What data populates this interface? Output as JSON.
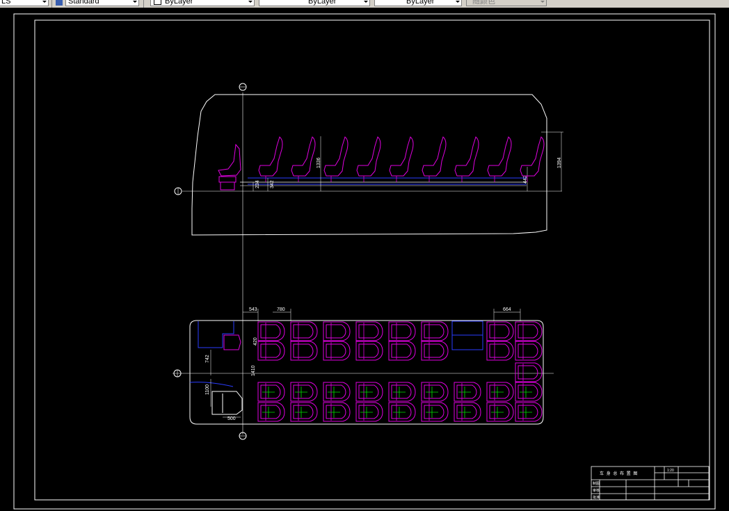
{
  "toolbar": {
    "combo1": "LS",
    "combo2": "Standard",
    "combo3": "ByLayer",
    "combo4": "ByLayer",
    "combo5": "ByLayer",
    "combo6": "随颜色"
  },
  "drawing": {
    "side_dims": [
      "234",
      "342",
      "1336",
      "442",
      "1394"
    ],
    "plan_dims": [
      "543",
      "780",
      "664",
      "420",
      "1410",
      "742",
      "1100",
      "500"
    ],
    "title_block": {
      "title": "车 身 总 布 置 图",
      "scale": "1:20",
      "rows": [
        "制图",
        "审核",
        "批准"
      ]
    }
  }
}
